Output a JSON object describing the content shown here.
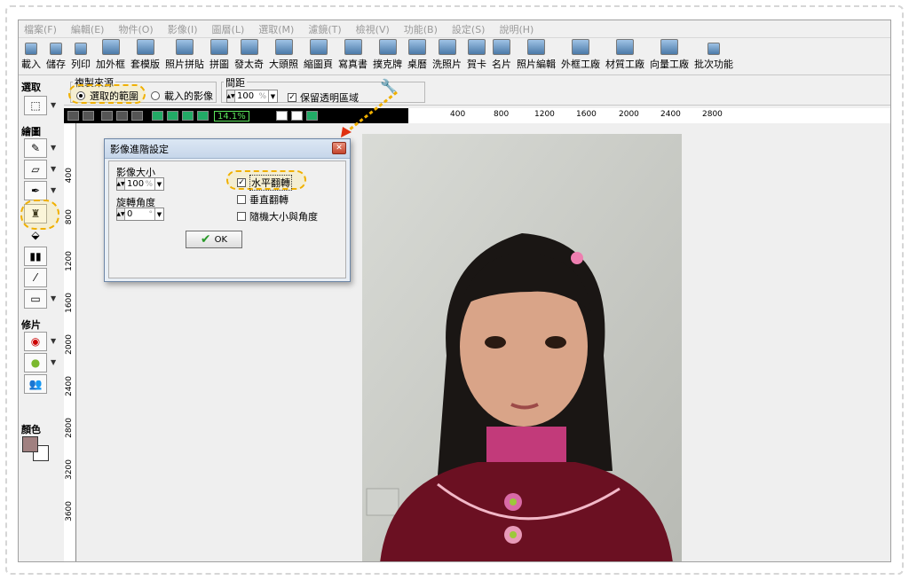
{
  "menu": [
    "檔案(F)",
    "編輯(E)",
    "物件(O)",
    "影像(I)",
    "圖層(L)",
    "選取(M)",
    "濾鏡(T)",
    "檢視(V)",
    "功能(B)",
    "設定(S)",
    "說明(H)"
  ],
  "toolbar": [
    "載入",
    "儲存",
    "列印",
    "加外框",
    "套模版",
    "照片拼貼",
    "拼圖",
    "發太奇",
    "大頭照",
    "縮圖頁",
    "寫真書",
    "撲克牌",
    "桌曆",
    "洗照片",
    "賀卡",
    "名片",
    "照片編輯",
    "外框工廠",
    "材質工廠",
    "向量工廠",
    "批次功能"
  ],
  "left": {
    "select": "選取",
    "draw": "繪圖",
    "retouch": "修片",
    "color": "顏色"
  },
  "options": {
    "source_title": "複製來源",
    "source_selection": "選取的範圍",
    "source_loaded": "載入的影像",
    "spacing_title": "間距",
    "spacing_value": "100",
    "spacing_unit": "%",
    "keep_transparent": "保留透明區域"
  },
  "view": {
    "zoom": "14.1%"
  },
  "ruler_top": [
    "400",
    "800",
    "1200",
    "1600",
    "2000",
    "2400",
    "2800"
  ],
  "ruler_left": [
    "400",
    "800",
    "1200",
    "1600",
    "2000",
    "2400",
    "2800",
    "3200",
    "3600"
  ],
  "dialog": {
    "title": "影像進階設定",
    "size_label": "影像大小",
    "size_value": "100",
    "size_unit": "%",
    "rotate_label": "旋轉角度",
    "rotate_value": "0",
    "rotate_unit": "°",
    "flip_h": "水平翻轉",
    "flip_v": "垂直翻轉",
    "random": "隨機大小與角度",
    "ok": "OK"
  },
  "colors": {
    "accent_highlight": "#f0b000",
    "foreground_swatch": "#a08080"
  }
}
